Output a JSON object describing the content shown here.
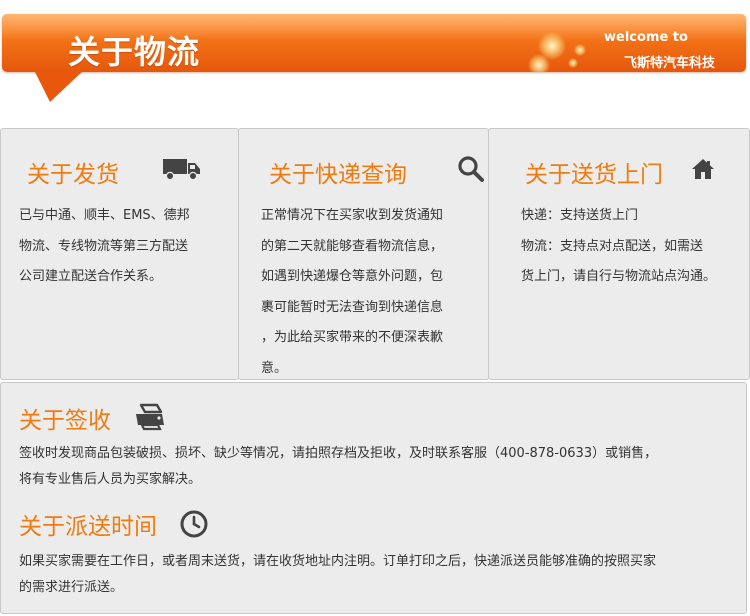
{
  "banner": {
    "title": "关于物流",
    "welcome": "welcome to",
    "company": "飞斯特汽车科技",
    "accent_color": "#f27016"
  },
  "panels": [
    {
      "title": "关于发货",
      "icon": "truck-icon",
      "lines": [
        "已与中通、顺丰、EMS、德邦",
        "物流、专线物流等第三方配送",
        "公司建立配送合作关系。"
      ]
    },
    {
      "title": "关于快递查询",
      "icon": "search-icon",
      "lines": [
        "正常情况下在买家收到发货通知",
        "的第二天就能够查看物流信息，",
        "如遇到快递爆仓等意外问题，包",
        "裹可能暂时无法查询到快递信息",
        "，为此给买家带来的不便深表歉",
        "意。"
      ]
    },
    {
      "title": "关于送货上门",
      "icon": "home-icon",
      "lines": [
        "快递：支持送货上门",
        "物流：支持点对点配送，如需送",
        "货上门，请自行与物流站点沟通。"
      ]
    }
  ],
  "sections": [
    {
      "title": "关于签收",
      "icon": "printer-icon",
      "lines": [
        "签收时发现商品包装破损、损坏、缺少等情况，请拍照存档及拒收，及时联系客服（400-878-0633）或销售，",
        "将有专业售后人员为买家解决。"
      ]
    },
    {
      "title": "关于派送时间",
      "icon": "clock-icon",
      "lines": [
        "如果买家需要在工作日，或者周末送货，请在收货地址内注明。订单打印之后，快递派送员能够准确的按照买家",
        "的需求进行派送。"
      ]
    }
  ],
  "colors": {
    "heading": "#f07b0f",
    "panel_bg": "#ececec",
    "icon": "#444444"
  }
}
